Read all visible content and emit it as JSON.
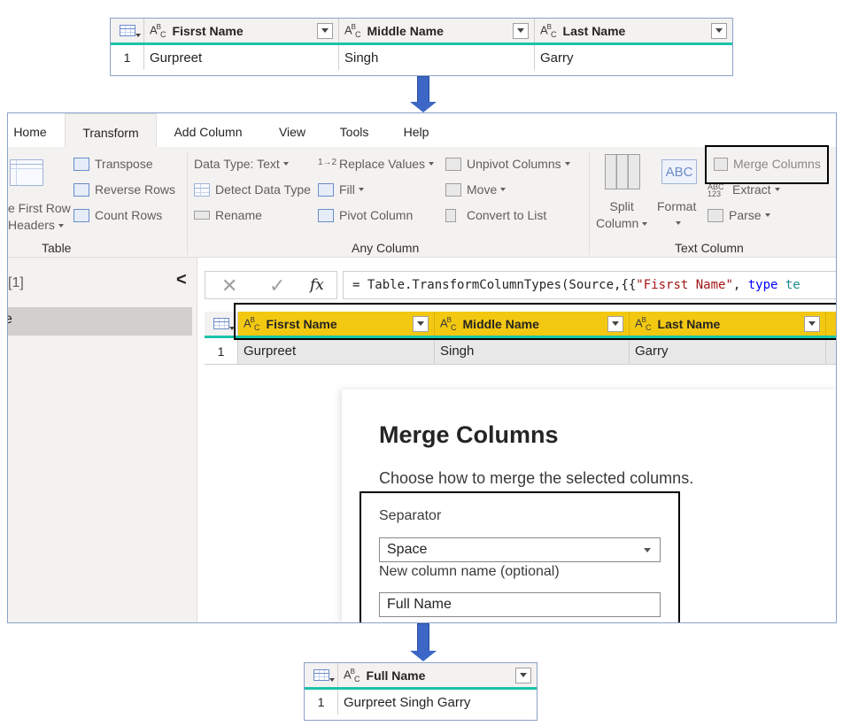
{
  "top_table": {
    "columns": [
      "Fisrst Name",
      "Middle Name",
      "Last Name"
    ],
    "row_num": "1",
    "row": [
      "Gurpreet",
      "Singh",
      "Garry"
    ]
  },
  "tabs": [
    "Home",
    "Transform",
    "Add Column",
    "View",
    "Tools",
    "Help"
  ],
  "active_tab": "Transform",
  "ribbon": {
    "table_group": {
      "label": "Table",
      "use_first_row_line1": "e First Row",
      "use_first_row_line2": "Headers",
      "transpose": "Transpose",
      "reverse_rows": "Reverse Rows",
      "count_rows": "Count Rows"
    },
    "any_column_group": {
      "label": "Any Column",
      "data_type": "Data Type: Text",
      "detect_data_type": "Detect Data Type",
      "rename": "Rename",
      "replace_values": "Replace Values",
      "fill": "Fill",
      "pivot_column": "Pivot Column",
      "unpivot_columns": "Unpivot Columns",
      "move": "Move",
      "convert_to_list": "Convert to List"
    },
    "text_column_group": {
      "label": "Text Column",
      "split_column_line1": "Split",
      "split_column_line2": "Column",
      "format": "Format",
      "format_icon_text": "ABC",
      "merge_columns": "Merge Columns",
      "extract": "Extract",
      "parse": "Parse"
    }
  },
  "left_pane": {
    "query_count": "[1]",
    "collapse": "<",
    "selected_item": "e"
  },
  "formula_bar": {
    "cancel": "✕",
    "commit": "✓",
    "fx": "fx",
    "prefix": "= Table.TransformColumnTypes(Source,{{",
    "string": "\"Fisrst Name\"",
    "sep": ", ",
    "keyword": "type",
    "tail": " te"
  },
  "editor_table": {
    "columns": [
      "Fisrst Name",
      "Middle Name",
      "Last Name"
    ],
    "row_num": "1",
    "row": [
      "Gurpreet",
      "Singh",
      "Garry"
    ]
  },
  "dialog": {
    "title": "Merge Columns",
    "subtitle": "Choose how to merge the selected columns.",
    "separator_label": "Separator",
    "separator_value": "Space",
    "new_col_label": "New column name (optional)",
    "new_col_value": "Full Name"
  },
  "result_table": {
    "column": "Full Name",
    "row_num": "1",
    "row": "Gurpreet Singh Garry"
  },
  "colors": {
    "accent_teal": "#1bc3a8",
    "selected_header": "#f3c811",
    "arrow": "#3d67c6"
  }
}
